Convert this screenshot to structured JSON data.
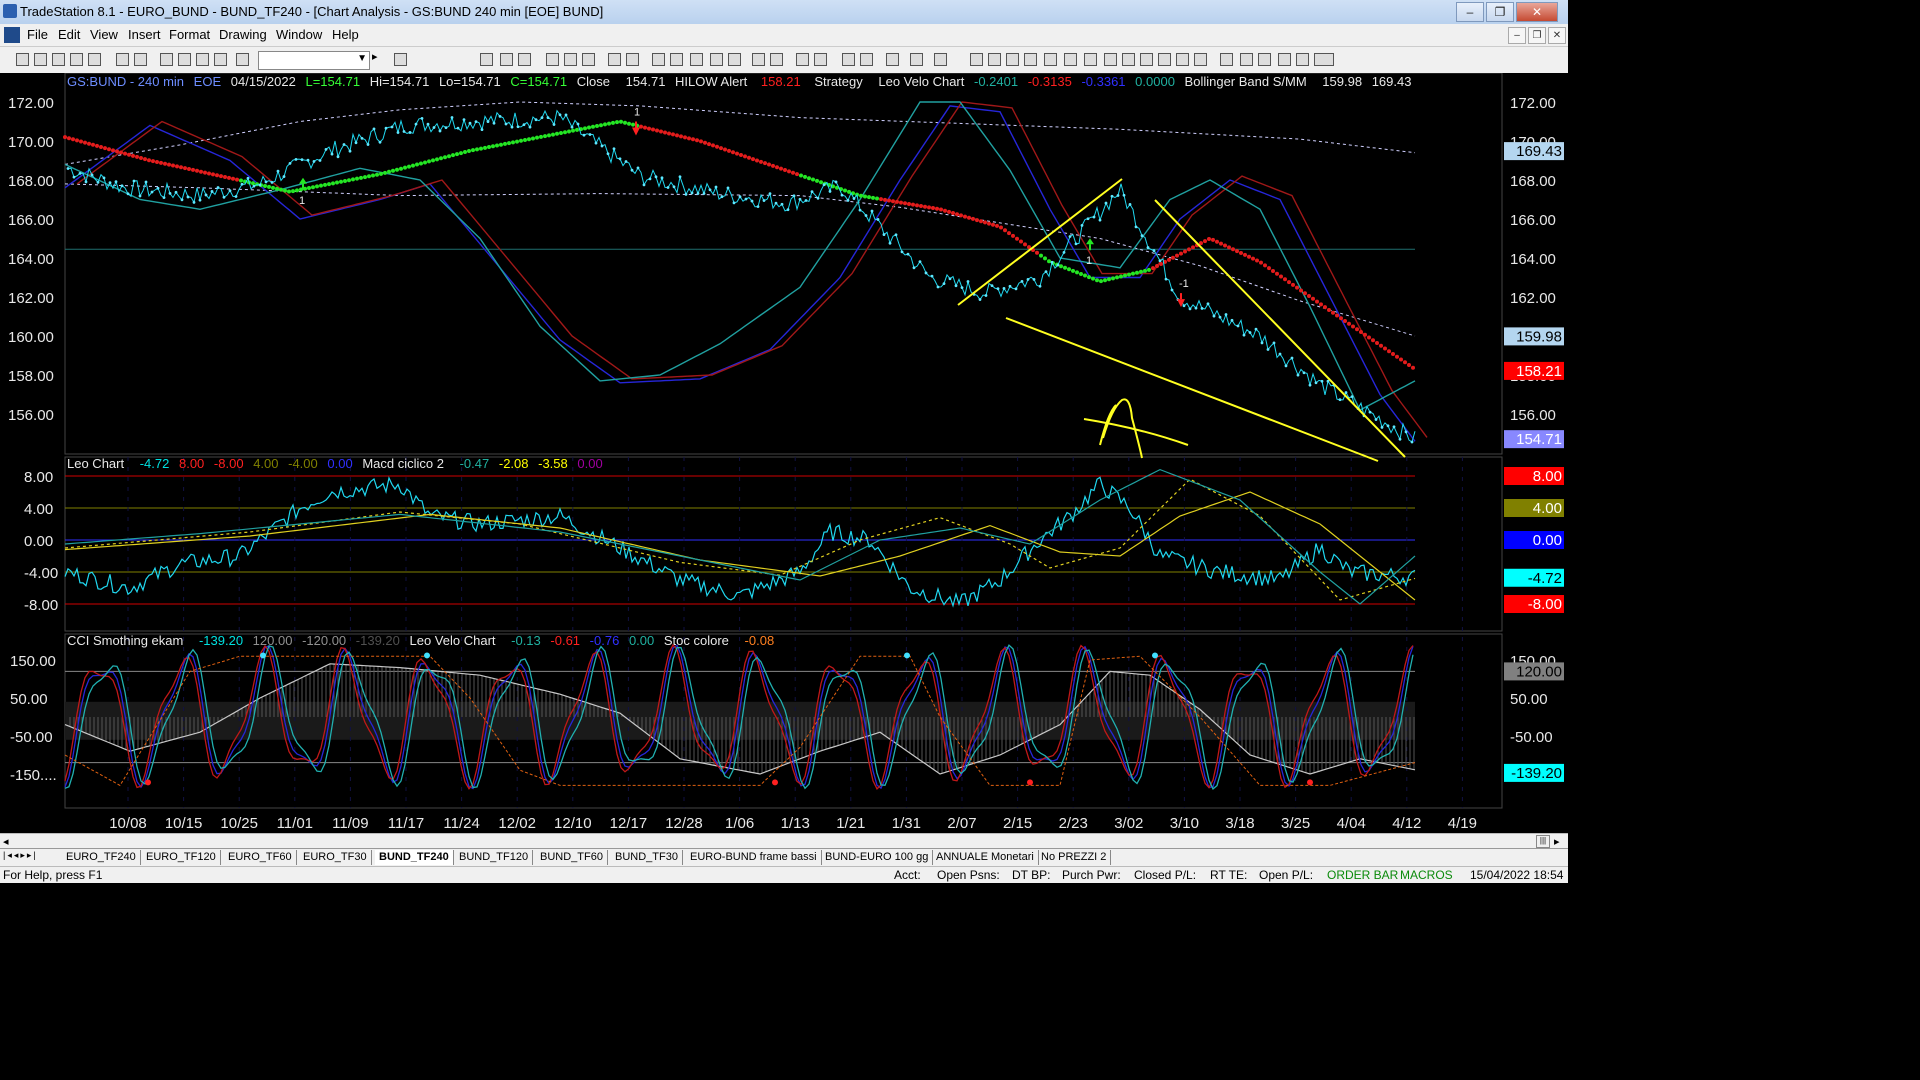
{
  "window": {
    "title": "TradeStation 8.1 - EURO_BUND - BUND_TF240 - [Chart Analysis - GS:BUND  240 min  [EOE] BUND]"
  },
  "menu": [
    "File",
    "Edit",
    "View",
    "Insert",
    "Format",
    "Drawing",
    "Window",
    "Help"
  ],
  "header": {
    "symbol": "GS:BUND - 240 min",
    "exchange": "EOE",
    "date": "04/15/2022",
    "low_label": "L=154.71",
    "hi": "Hi=154.71",
    "lo": "Lo=154.71",
    "close_label": "C=154.71",
    "close_word": "Close",
    "close_val": "154.71",
    "hilow_name": "HILOW Alert",
    "hilow_val": "158.21",
    "strategy": "Strategy",
    "leo_velo": "Leo Velo Chart",
    "lv1": "-0.2401",
    "lv2": "-0.3135",
    "lv3": "-0.3361",
    "lv4": "0.0000",
    "bb_name": "Bollinger Band S/MM",
    "bb1": "159.98",
    "bb2": "169.43"
  },
  "panel2_header": {
    "name": "Leo Chart",
    "v1": "-4.72",
    "v2": "8.00",
    "v3": "-8.00",
    "v4": "4.00",
    "v5": "-4.00",
    "v6": "0.00",
    "name2": "Macd ciclico 2",
    "m1": "-0.47",
    "m2": "-2.08",
    "m3": "-3.58",
    "m4": "0.00"
  },
  "panel3_header": {
    "name": "CCI Smothing ekam",
    "c1": "-139.20",
    "c2": "120.00",
    "c3": "-120.00",
    "c4": "-139.20",
    "name2": "Leo Velo Chart",
    "l1": "-0.13",
    "l2": "-0.61",
    "l3": "-0.76",
    "l4": "0.00",
    "name3": "Stoc colore",
    "s1": "-0.08"
  },
  "price_axis_left": [
    "172.00",
    "170.00",
    "168.00",
    "166.00",
    "164.00",
    "162.00",
    "160.00",
    "158.00",
    "156.00"
  ],
  "price_axis_right": [
    "172.00",
    "170.00",
    "168.00",
    "166.00",
    "164.00",
    "162.00",
    "160.00",
    "158.00",
    "156.00"
  ],
  "price_tags": [
    {
      "text": "169.43",
      "color": "#b4d6f0"
    },
    {
      "text": "159.98",
      "color": "#b4d6f0"
    },
    {
      "text": "158.21",
      "color": "#ff0000"
    },
    {
      "text": "154.71",
      "color": "#8888ff"
    }
  ],
  "osc_axis": [
    "8.00",
    "4.00",
    "0.00",
    "-4.00",
    "-8.00"
  ],
  "osc_tags": [
    {
      "text": "8.00",
      "color": "#ff0000"
    },
    {
      "text": "4.00",
      "color": "#808000"
    },
    {
      "text": "0.00",
      "color": "#0000ff"
    },
    {
      "text": "-4.72",
      "color": "#00ffff"
    },
    {
      "text": "-8.00",
      "color": "#ff0000"
    }
  ],
  "cci_axis": [
    "150.00",
    "50.00",
    "-50.00",
    "-150...."
  ],
  "cci_axis_right": [
    "150.00",
    "50.00",
    "-50.00",
    "-150.00"
  ],
  "cci_tags": [
    {
      "text": "120.00",
      "color": "#808080"
    },
    {
      "text": "-139.20",
      "color": "#00ffff"
    }
  ],
  "date_axis": [
    "10/08",
    "10/15",
    "10/25",
    "11/01",
    "11/09",
    "11/17",
    "11/24",
    "12/02",
    "12/10",
    "12/17",
    "12/28",
    "1/06",
    "1/13",
    "1/21",
    "1/31",
    "2/07",
    "2/15",
    "2/23",
    "3/02",
    "3/10",
    "3/18",
    "3/25",
    "4/04",
    "4/12",
    "4/19"
  ],
  "chart_data": {
    "type": "line",
    "title": "GS:BUND - 240 min",
    "ylim": [
      154,
      173
    ],
    "series": [
      {
        "name": "Close",
        "values": [
          168.6,
          167.6,
          167.2,
          167.8,
          169.5,
          170.8,
          171.0,
          171.2,
          168.2,
          167.3,
          166.8,
          167.7,
          163.0,
          162.2,
          163.0,
          167.5,
          162.0,
          160.0,
          157.5,
          154.71
        ]
      }
    ]
  },
  "tabs": [
    "EURO_TF240",
    "EURO_TF120",
    "EURO_TF60",
    "EURO_TF30",
    "BUND_TF240",
    "BUND_TF120",
    "BUND_TF60",
    "BUND_TF30",
    "EURO-BUND frame bassi",
    "BUND-EURO 100 gg",
    "ANNUALE Monetari",
    "No PREZZI 2"
  ],
  "active_tab": "BUND_TF240",
  "status": {
    "help": "For Help, press F1",
    "acct": "Acct:",
    "open_psns": "Open Psns:",
    "dt_bp": "DT BP:",
    "purch": "Purch Pwr:",
    "closed": "Closed P/L:",
    "rt_te": "RT TE:",
    "open_pl": "Open P/L:",
    "orderbar": "ORDER BAR",
    "macros": "MACROS",
    "datetime": "15/04/2022 18:54"
  },
  "annotations": [
    "1",
    "1",
    "1",
    "-1",
    "A"
  ]
}
